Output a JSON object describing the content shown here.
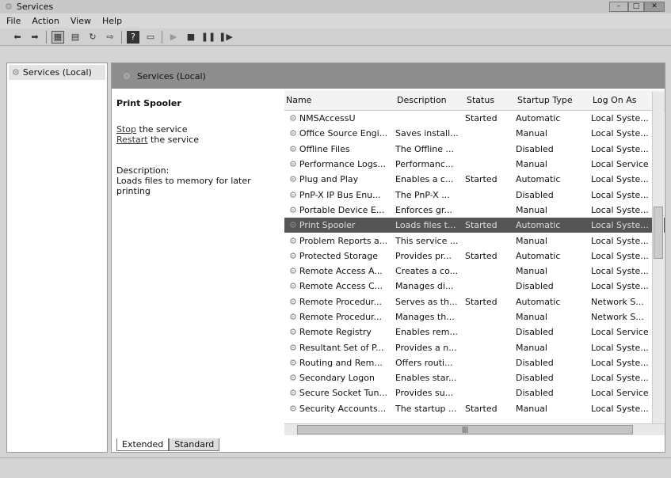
{
  "window": {
    "title": "Services",
    "minimize": "–",
    "maximize": "□",
    "close": "✕"
  },
  "menu": [
    "File",
    "Action",
    "View",
    "Help"
  ],
  "toolbar": [
    "back-icon",
    "forward-icon",
    "console-tree-icon",
    "properties-icon",
    "refresh-icon",
    "export-icon",
    "help-icon",
    "view-icon",
    "start-icon",
    "stop-icon",
    "pause-icon",
    "resume-icon"
  ],
  "tree": {
    "item": "Services (Local)"
  },
  "header": {
    "title": "Services (Local)"
  },
  "details": {
    "service": "Print Spooler",
    "stop_link": "Stop",
    "stop_rest": " the service",
    "restart_link": "Restart",
    "restart_rest": " the service",
    "desc_label": "Description:",
    "desc_text": "Loads files to memory for later printing"
  },
  "columns": [
    "Name",
    "Description",
    "Status",
    "Startup Type",
    "Log On As"
  ],
  "rows": [
    [
      "NMSAccessU",
      "",
      "Started",
      "Automatic",
      "Local Syste..."
    ],
    [
      "Office Source Engi...",
      "Saves install...",
      "",
      "Manual",
      "Local Syste..."
    ],
    [
      "Offline Files",
      "The Offline ...",
      "",
      "Disabled",
      "Local Syste..."
    ],
    [
      "Performance Logs...",
      "Performanc...",
      "",
      "Manual",
      "Local Service"
    ],
    [
      "Plug and Play",
      "Enables a c...",
      "Started",
      "Automatic",
      "Local Syste..."
    ],
    [
      "PnP-X IP Bus Enu...",
      "The PnP-X ...",
      "",
      "Disabled",
      "Local Syste..."
    ],
    [
      "Portable Device E...",
      "Enforces gr...",
      "",
      "Manual",
      "Local Syste..."
    ],
    [
      "Print Spooler",
      "Loads files t...",
      "Started",
      "Automatic",
      "Local Syste..."
    ],
    [
      "Problem Reports a...",
      "This service ...",
      "",
      "Manual",
      "Local Syste..."
    ],
    [
      "Protected Storage",
      "Provides pr...",
      "Started",
      "Automatic",
      "Local Syste..."
    ],
    [
      "Remote Access A...",
      "Creates a co...",
      "",
      "Manual",
      "Local Syste..."
    ],
    [
      "Remote Access C...",
      "Manages di...",
      "",
      "Disabled",
      "Local Syste..."
    ],
    [
      "Remote Procedur...",
      "Serves as th...",
      "Started",
      "Automatic",
      "Network S..."
    ],
    [
      "Remote Procedur...",
      "Manages th...",
      "",
      "Manual",
      "Network S..."
    ],
    [
      "Remote Registry",
      "Enables rem...",
      "",
      "Disabled",
      "Local Service"
    ],
    [
      "Resultant Set of P...",
      "Provides a n...",
      "",
      "Manual",
      "Local Syste..."
    ],
    [
      "Routing and Rem...",
      "Offers routi...",
      "",
      "Disabled",
      "Local Syste..."
    ],
    [
      "Secondary Logon",
      "Enables star...",
      "",
      "Disabled",
      "Local Syste..."
    ],
    [
      "Secure Socket Tun...",
      "Provides su...",
      "",
      "Disabled",
      "Local Service"
    ],
    [
      "Security Accounts...",
      "The startup ...",
      "Started",
      "Manual",
      "Local Syste..."
    ]
  ],
  "selected_row": 7,
  "tabs": [
    "Extended",
    "Standard"
  ]
}
